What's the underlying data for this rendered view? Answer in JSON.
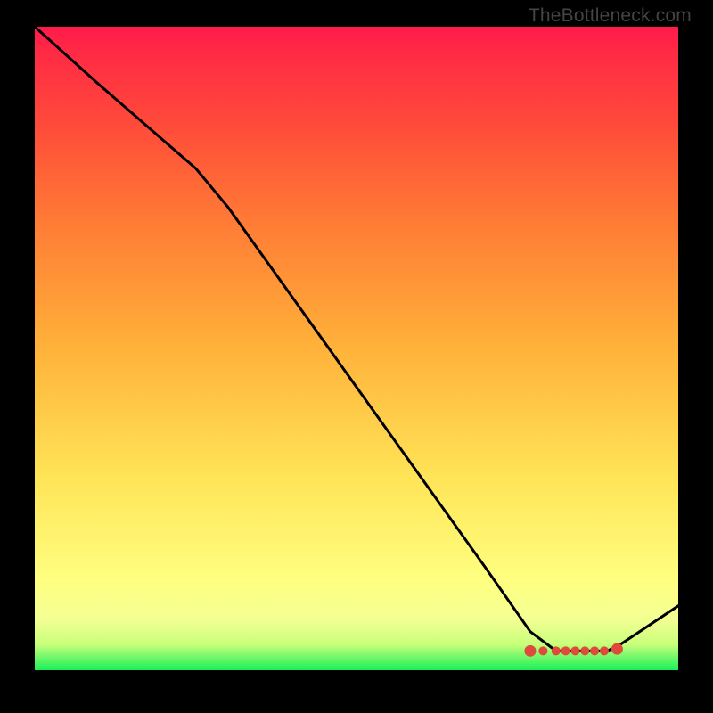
{
  "watermark": "TheBottleneck.com",
  "chart_data": {
    "type": "line",
    "title": "",
    "xlabel": "",
    "ylabel": "",
    "xlim": [
      0,
      100
    ],
    "ylim": [
      0,
      100
    ],
    "series": [
      {
        "name": "curve",
        "x": [
          0,
          10,
          25,
          30,
          40,
          50,
          60,
          70,
          77,
          81,
          85,
          89,
          91,
          100
        ],
        "y": [
          100,
          91,
          78,
          72,
          58,
          44,
          30,
          16,
          6,
          3,
          3,
          3,
          4,
          10
        ]
      }
    ],
    "markers": {
      "name": "highlight-dots",
      "x": [
        77,
        79,
        81,
        82.5,
        84,
        85.5,
        87,
        88.5,
        90.5
      ],
      "y": [
        3.0,
        3.0,
        3.0,
        3.0,
        3.0,
        3.0,
        3.0,
        3.0,
        3.3
      ]
    },
    "gradient_stops": [
      {
        "offset": 0,
        "color": "#18f05a"
      },
      {
        "offset": 4,
        "color": "#c8ff7a"
      },
      {
        "offset": 8,
        "color": "#f4ff94"
      },
      {
        "offset": 14,
        "color": "#ffff80"
      },
      {
        "offset": 30,
        "color": "#ffe457"
      },
      {
        "offset": 50,
        "color": "#ffb23a"
      },
      {
        "offset": 70,
        "color": "#ff7a35"
      },
      {
        "offset": 85,
        "color": "#ff4a3a"
      },
      {
        "offset": 96,
        "color": "#ff2a45"
      },
      {
        "offset": 100,
        "color": "#ff1a4a"
      }
    ],
    "marker_color": "#e04a3a",
    "line_color": "#000000"
  }
}
